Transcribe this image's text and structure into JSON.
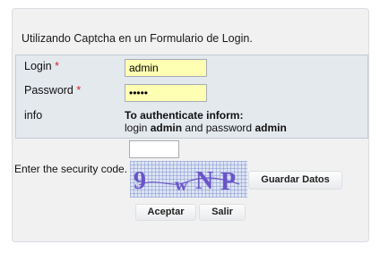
{
  "panel": {
    "title": "Utilizando Captcha en un Formulario de Login."
  },
  "form": {
    "login_label": "Login",
    "password_label": "Password",
    "required_mark": "*",
    "login_value": "admin",
    "password_value": "admin",
    "info_label": "info",
    "info_heading": "To authenticate inform:",
    "info_word_login": "login",
    "info_value_login": "admin",
    "info_word_and_password": "and password",
    "info_value_password": "admin"
  },
  "captcha": {
    "input_value": "",
    "label": "Enter the security code.",
    "image_text": "9wNP",
    "chars": [
      "9",
      "w",
      "N",
      "P"
    ],
    "text_color": "#6a54c8",
    "background_color": "#dde4f4"
  },
  "buttons": {
    "save_label": "Guardar Datos",
    "accept_label": "Aceptar",
    "exit_label": "Salir"
  }
}
